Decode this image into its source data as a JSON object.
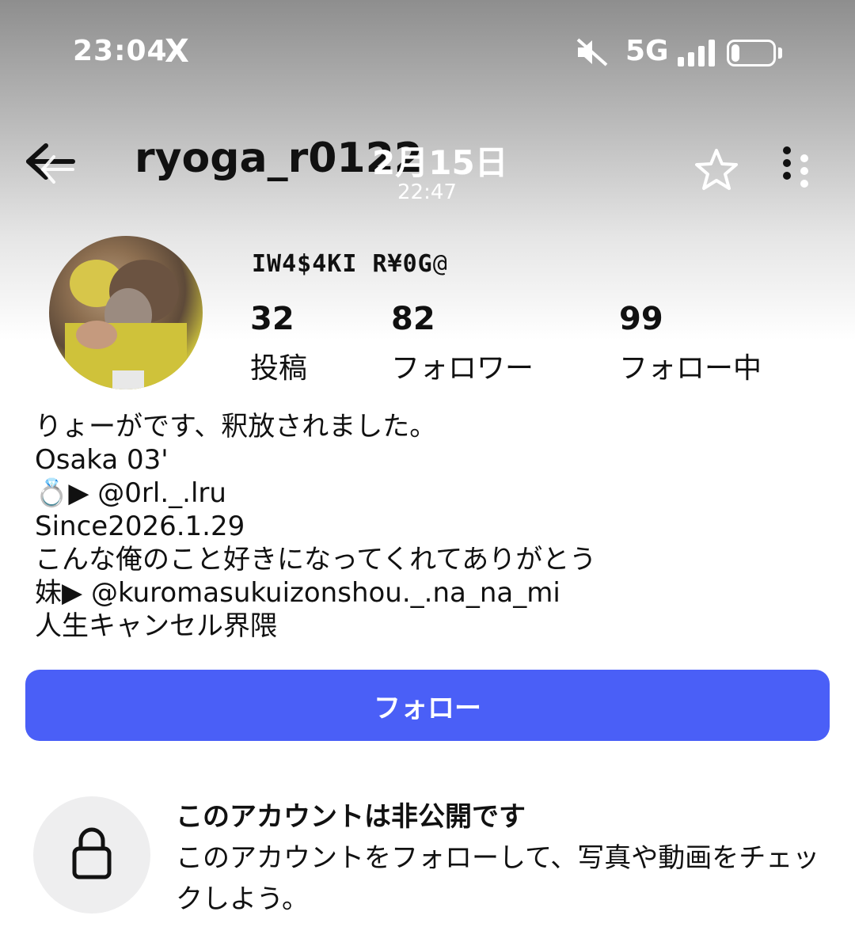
{
  "status_bar": {
    "time": "23:04",
    "x_icon": "X",
    "network": "5G",
    "signal_level": 4,
    "battery_level": 0.2
  },
  "header": {
    "username": "ryoga_r0122",
    "date_overlay": "2月15日",
    "time_overlay": "22:47",
    "icons": [
      "back-arrow-icon",
      "star-icon",
      "more-vertical-icon"
    ]
  },
  "profile": {
    "display_name": "IW4$4KI R¥0G",
    "display_name_glyph": "@",
    "stats": [
      {
        "value": "32",
        "label": "投稿"
      },
      {
        "value": "82",
        "label": "フォロワー"
      },
      {
        "value": "99",
        "label": "フォロー中"
      }
    ],
    "bio": [
      "りょーがです、釈放されました。",
      "Osaka 03'",
      "💍▶ @0rl._.lru",
      "Since2026.1.29",
      "こんな俺のこと好きになってくれてありがとう",
      "妹▶ @kuromasukuizonshou._.na_na_mi",
      "人生キャンセル界隈"
    ]
  },
  "follow_button": {
    "label": "フォロー",
    "color": "#4a5ff7"
  },
  "private_notice": {
    "title": "このアカウントは非公開です",
    "description": "このアカウントをフォローして、写真や動画をチェックしよう。",
    "icon": "lock-icon"
  }
}
